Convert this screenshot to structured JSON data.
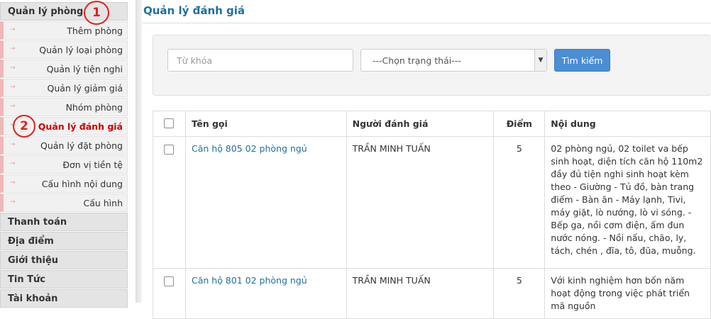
{
  "sidebar": {
    "group_main": "Quản lý phòng",
    "items": [
      {
        "label": "Thêm phòng"
      },
      {
        "label": "Quản lý loại phòng"
      },
      {
        "label": "Quản lý tiện nghi"
      },
      {
        "label": "Quản lý giảm giá"
      },
      {
        "label": "Nhóm phòng"
      },
      {
        "label": "Quản lý đánh giá",
        "active": true
      },
      {
        "label": "Quản lý đặt phòng"
      },
      {
        "label": "Đơn vị tiền tệ"
      },
      {
        "label": "Cấu hình nội dung"
      },
      {
        "label": "Cấu hình"
      }
    ],
    "groups": [
      {
        "label": "Thanh toán"
      },
      {
        "label": "Địa điểm"
      },
      {
        "label": "Giới thiệu"
      },
      {
        "label": "Tin Tức"
      },
      {
        "label": "Tài khoản"
      }
    ]
  },
  "annotations": {
    "marker1": "1",
    "marker2": "2",
    "color": "#e02020"
  },
  "page": {
    "title": "Quản lý đánh giá"
  },
  "filters": {
    "keyword_placeholder": "Từ khóa",
    "keyword_value": "",
    "status_selected": "---Chọn trạng thái---",
    "search_label": "Tìm kiếm"
  },
  "table": {
    "headers": {
      "name": "Tên gọi",
      "reviewer": "Người đánh giá",
      "score": "Điểm",
      "content": "Nội dung"
    },
    "rows": [
      {
        "name": "Căn hộ 805 02 phòng ngủ",
        "reviewer": "TRẦN MINH TUẤN",
        "score": "5",
        "content": "02 phòng ngủ, 02 toilet va bếp sinh hoạt, diện tích căn hộ 110m2 đầy đủ tiện nghi sinh hoạt kèm theo - Giường - Tủ đồ, bàn trang điểm - Bàn ăn - Máy lạnh, Tivi, máy giặt, lò nướng, lò vi sóng. - Bếp ga, nồi cơm điện, ấm đun nước nóng. - Nồi nấu, chão, ly, tách, chén , đĩa, tô, đũa, muỗng."
      },
      {
        "name": "Căn hộ 801 02 phòng ngủ",
        "reviewer": "TRẦN MINH TUẤN",
        "score": "5",
        "content": "Với kinh nghiệm hơn bốn năm hoạt động trong việc phát triển mã nguồn"
      }
    ]
  },
  "colors": {
    "accent": "#1f6f9e",
    "button": "#4a8ed4",
    "active_menu": "#cc0000"
  }
}
